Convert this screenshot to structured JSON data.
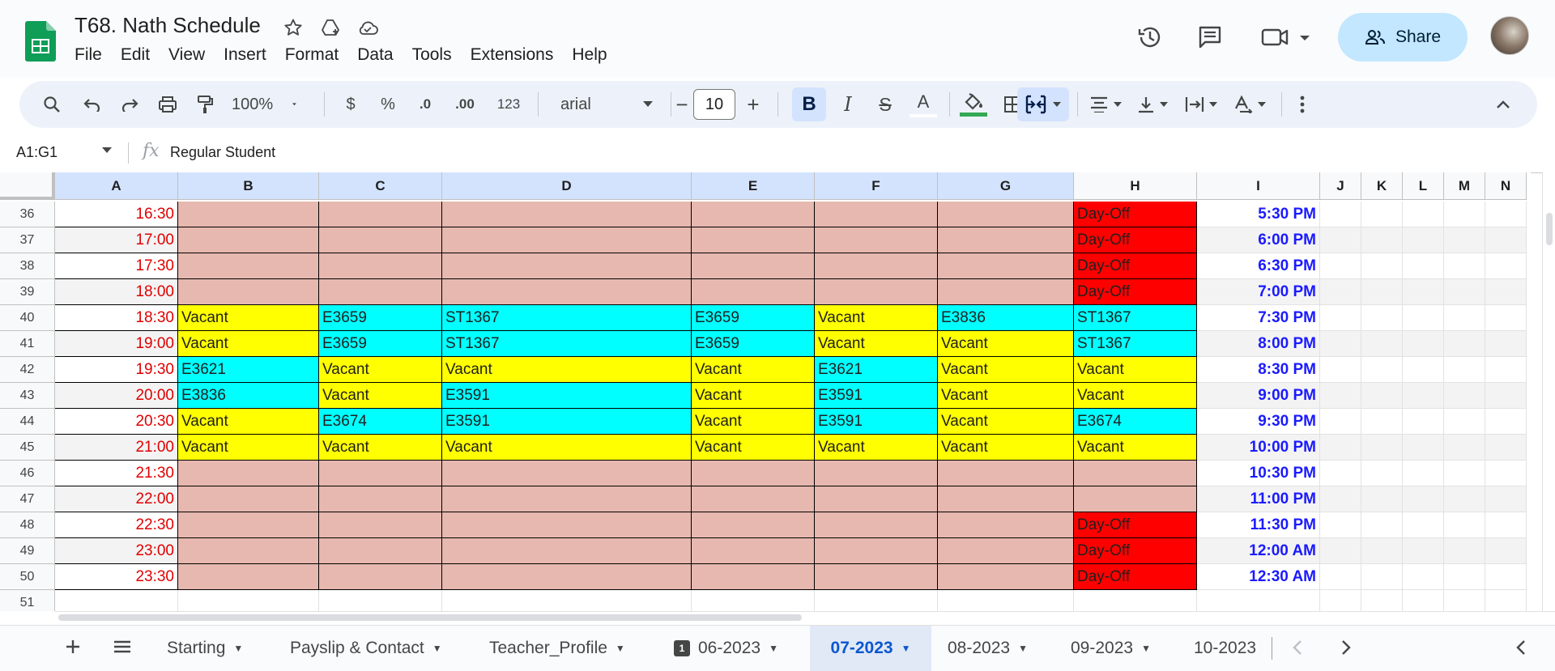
{
  "doc": {
    "title": "T68. Nath Schedule"
  },
  "menu": [
    "File",
    "Edit",
    "View",
    "Insert",
    "Format",
    "Data",
    "Tools",
    "Extensions",
    "Help"
  ],
  "share": {
    "label": "Share"
  },
  "toolbar": {
    "zoom": "100%",
    "currency": "$",
    "percent": "%",
    "dec_less": ".0",
    "dec_more": ".00",
    "number_format": "123",
    "font": "arial",
    "font_size": "10",
    "minus": "−",
    "plus": "+",
    "bold": "B",
    "italic": "I",
    "strike": "S",
    "text_color": "A"
  },
  "formula_bar": {
    "name_box": "A1:G1",
    "fx": "fx",
    "content": "Regular Student"
  },
  "columns": [
    "A",
    "B",
    "C",
    "D",
    "E",
    "F",
    "G",
    "H",
    "I",
    "J",
    "K",
    "L",
    "M",
    "N"
  ],
  "selected_columns": [
    "A",
    "B",
    "C",
    "D",
    "E",
    "F",
    "G"
  ],
  "rows": [
    {
      "n": "36",
      "a": "16:30",
      "b": "",
      "c": "",
      "d": "",
      "e": "",
      "f": "",
      "g": "",
      "h": "Day-Off",
      "i": "5:30 PM"
    },
    {
      "n": "37",
      "a": "17:00",
      "b": "",
      "c": "",
      "d": "",
      "e": "",
      "f": "",
      "g": "",
      "h": "Day-Off",
      "i": "6:00 PM"
    },
    {
      "n": "38",
      "a": "17:30",
      "b": "",
      "c": "",
      "d": "",
      "e": "",
      "f": "",
      "g": "",
      "h": "Day-Off",
      "i": "6:30 PM"
    },
    {
      "n": "39",
      "a": "18:00",
      "b": "",
      "c": "",
      "d": "",
      "e": "",
      "f": "",
      "g": "",
      "h": "Day-Off",
      "i": "7:00 PM"
    },
    {
      "n": "40",
      "a": "18:30",
      "b": "Vacant",
      "c": "E3659",
      "d": "ST1367",
      "e": "E3659",
      "f": "Vacant",
      "g": "E3836",
      "h": "ST1367",
      "i": "7:30 PM"
    },
    {
      "n": "41",
      "a": "19:00",
      "b": "Vacant",
      "c": "E3659",
      "d": "ST1367",
      "e": "E3659",
      "f": "Vacant",
      "g": "Vacant",
      "h": "ST1367",
      "i": "8:00 PM"
    },
    {
      "n": "42",
      "a": "19:30",
      "b": "E3621",
      "c": "Vacant",
      "d": "Vacant",
      "e": "Vacant",
      "f": "E3621",
      "g": "Vacant",
      "h": "Vacant",
      "i": "8:30 PM"
    },
    {
      "n": "43",
      "a": "20:00",
      "b": "E3836",
      "c": "Vacant",
      "d": "E3591",
      "e": "Vacant",
      "f": "E3591",
      "g": "Vacant",
      "h": "Vacant",
      "i": "9:00 PM"
    },
    {
      "n": "44",
      "a": "20:30",
      "b": "Vacant",
      "c": "E3674",
      "d": "E3591",
      "e": "Vacant",
      "f": "E3591",
      "g": "Vacant",
      "h": "E3674",
      "i": "9:30 PM"
    },
    {
      "n": "45",
      "a": "21:00",
      "b": "Vacant",
      "c": "Vacant",
      "d": "Vacant",
      "e": "Vacant",
      "f": "Vacant",
      "g": "Vacant",
      "h": "Vacant",
      "i": "10:00 PM"
    },
    {
      "n": "46",
      "a": "21:30",
      "b": "",
      "c": "",
      "d": "",
      "e": "",
      "f": "",
      "g": "",
      "h": "",
      "i": "10:30 PM"
    },
    {
      "n": "47",
      "a": "22:00",
      "b": "",
      "c": "",
      "d": "",
      "e": "",
      "f": "",
      "g": "",
      "h": "",
      "i": "11:00 PM"
    },
    {
      "n": "48",
      "a": "22:30",
      "b": "",
      "c": "",
      "d": "",
      "e": "",
      "f": "",
      "g": "",
      "h": "Day-Off",
      "i": "11:30 PM"
    },
    {
      "n": "49",
      "a": "23:00",
      "b": "",
      "c": "",
      "d": "",
      "e": "",
      "f": "",
      "g": "",
      "h": "Day-Off",
      "i": "12:00 AM"
    },
    {
      "n": "50",
      "a": "23:30",
      "b": "",
      "c": "",
      "d": "",
      "e": "",
      "f": "",
      "g": "",
      "h": "Day-Off",
      "i": "12:30 AM"
    },
    {
      "n": "51",
      "a": "",
      "b": "",
      "c": "",
      "d": "",
      "e": "",
      "f": "",
      "g": "",
      "h": "",
      "i": ""
    }
  ],
  "colors": {
    "booked_cell": "#00ffff",
    "vacant_cell": "#ffff00",
    "unavailable_cell": "#e6b8af",
    "day_off_cell": "#ff0000",
    "time_a_text": "#e00000",
    "time_i_text": "#1a1aff",
    "active_tab": "#0b57d0",
    "share_button": "#c2e7ff"
  },
  "tabs": [
    {
      "label": "Starting",
      "active": false,
      "badge": ""
    },
    {
      "label": "Payslip & Contact",
      "active": false,
      "badge": ""
    },
    {
      "label": "Teacher_Profile",
      "active": false,
      "badge": ""
    },
    {
      "label": "06-2023",
      "active": false,
      "badge": "1"
    },
    {
      "label": "07-2023",
      "active": true,
      "badge": ""
    },
    {
      "label": "08-2023",
      "active": false,
      "badge": ""
    },
    {
      "label": "09-2023",
      "active": false,
      "badge": ""
    },
    {
      "label": "10-2023",
      "active": false,
      "badge": ""
    }
  ]
}
